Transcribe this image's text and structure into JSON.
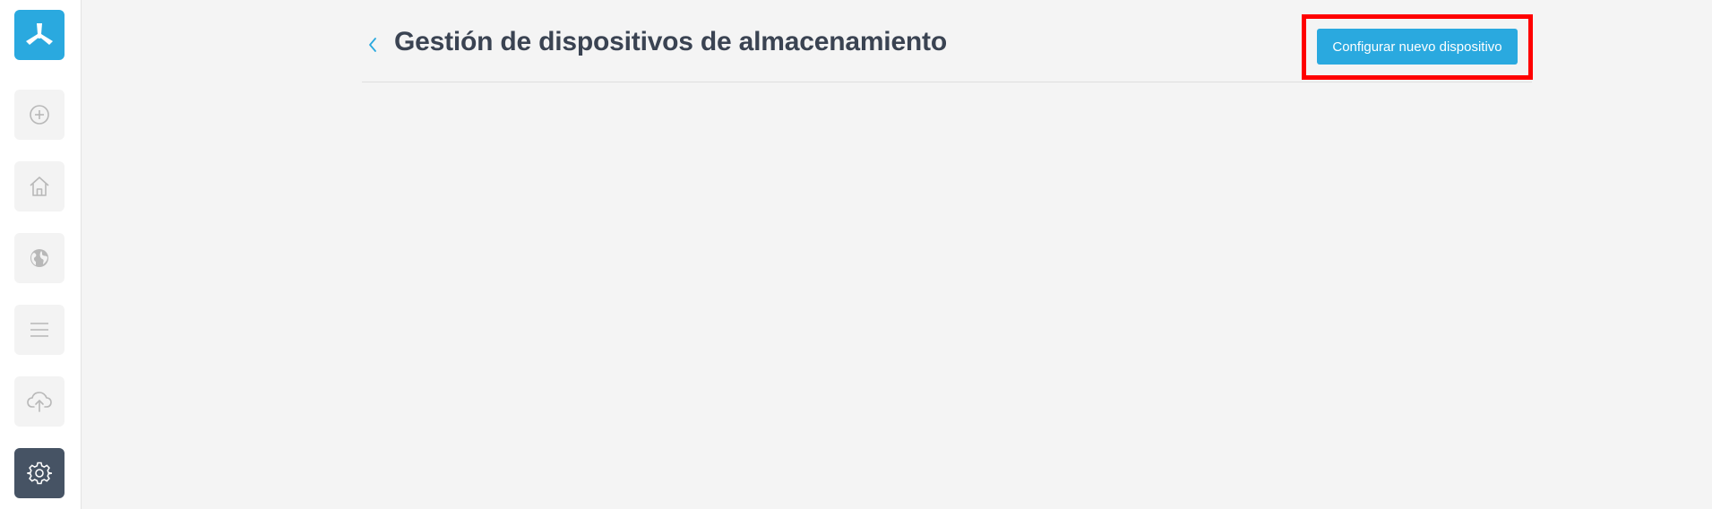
{
  "sidebar": {
    "items": [
      {
        "icon": "app-logo-icon",
        "state": "brand"
      },
      {
        "icon": "add-circle-icon"
      },
      {
        "icon": "home-icon"
      },
      {
        "icon": "globe-icon"
      },
      {
        "icon": "menu-lines-icon"
      },
      {
        "icon": "cloud-upload-icon"
      },
      {
        "icon": "gear-icon",
        "state": "active"
      }
    ]
  },
  "header": {
    "back_icon": "chevron-left-icon",
    "title": "Gestión de dispositivos de almacenamiento",
    "primary_button_label": "Configurar nuevo dispositivo"
  },
  "colors": {
    "accent": "#2aa9df",
    "active_nav": "#465364",
    "highlight": "#ff0000",
    "title_text": "#3a4352",
    "background": "#f4f4f4"
  }
}
